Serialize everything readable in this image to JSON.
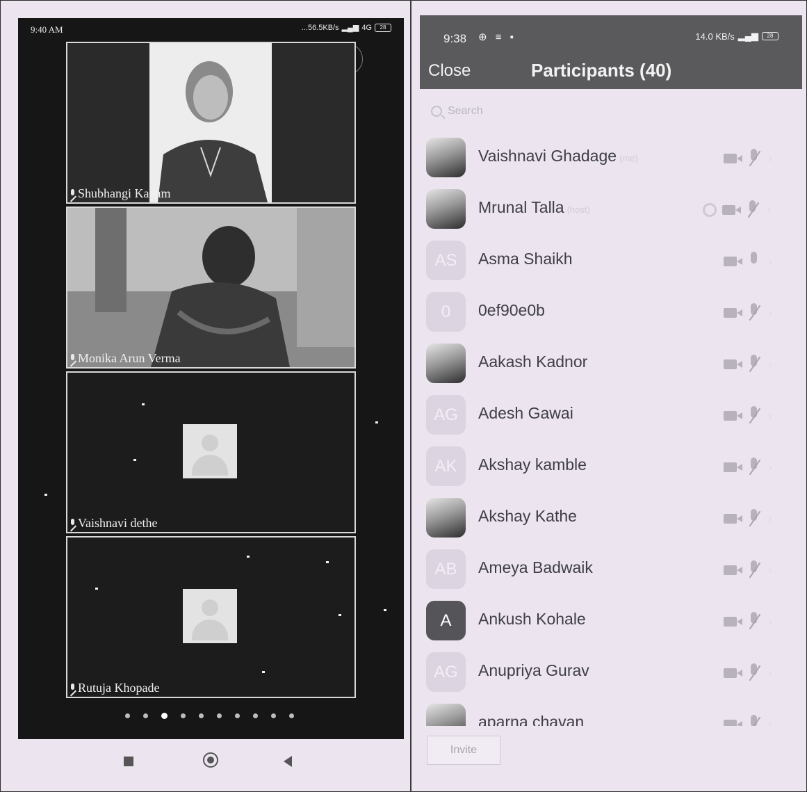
{
  "left": {
    "status": {
      "time": "9:40 AM",
      "speed": "...56.5KB/s",
      "network": "4G",
      "battery": "28"
    },
    "tiles": [
      {
        "name": "Shubhangi Kadam",
        "kind": "video"
      },
      {
        "name": "Monika Arun Verma",
        "kind": "video"
      },
      {
        "name": "Vaishnavi dethe",
        "kind": "avatar"
      },
      {
        "name": "Rutuja Khopade",
        "kind": "avatar"
      }
    ],
    "page_dots": {
      "total": 10,
      "active_index": 2
    }
  },
  "right": {
    "status": {
      "time": "9:38",
      "icons": "⊕ ≡ ▪",
      "right": "14.0 KB/s",
      "battery": "28"
    },
    "close_label": "Close",
    "title": "Participants (40)",
    "search_placeholder": "Search",
    "participants": [
      {
        "name": "Vaishnavi Ghadage",
        "tag": "(me)",
        "avatar": "photo",
        "initials": "",
        "share": false,
        "mic_muted": true
      },
      {
        "name": "Mrunal Talla",
        "tag": "(host)",
        "avatar": "photo",
        "initials": "",
        "share": true,
        "mic_muted": true
      },
      {
        "name": "Asma Shaikh",
        "tag": "",
        "avatar": "light",
        "initials": "AS",
        "share": false,
        "mic_muted": false
      },
      {
        "name": "0ef90e0b",
        "tag": "",
        "avatar": "light",
        "initials": "0",
        "share": false,
        "mic_muted": true
      },
      {
        "name": "Aakash Kadnor",
        "tag": "",
        "avatar": "photo",
        "initials": "",
        "share": false,
        "mic_muted": true
      },
      {
        "name": "Adesh Gawai",
        "tag": "",
        "avatar": "light",
        "initials": "AG",
        "share": false,
        "mic_muted": true
      },
      {
        "name": "Akshay kamble",
        "tag": "",
        "avatar": "light",
        "initials": "AK",
        "share": false,
        "mic_muted": true
      },
      {
        "name": "Akshay Kathe",
        "tag": "",
        "avatar": "photo",
        "initials": "",
        "share": false,
        "mic_muted": true
      },
      {
        "name": "Ameya Badwaik",
        "tag": "",
        "avatar": "light",
        "initials": "AB",
        "share": false,
        "mic_muted": true
      },
      {
        "name": "Ankush Kohale",
        "tag": "",
        "avatar": "dark",
        "initials": "A",
        "share": false,
        "mic_muted": true
      },
      {
        "name": "Anupriya Gurav",
        "tag": "",
        "avatar": "light",
        "initials": "AG",
        "share": false,
        "mic_muted": true
      },
      {
        "name": "aparna chavan",
        "tag": "",
        "avatar": "photo",
        "initials": "",
        "share": false,
        "mic_muted": true
      }
    ],
    "invite_label": "Invite"
  }
}
